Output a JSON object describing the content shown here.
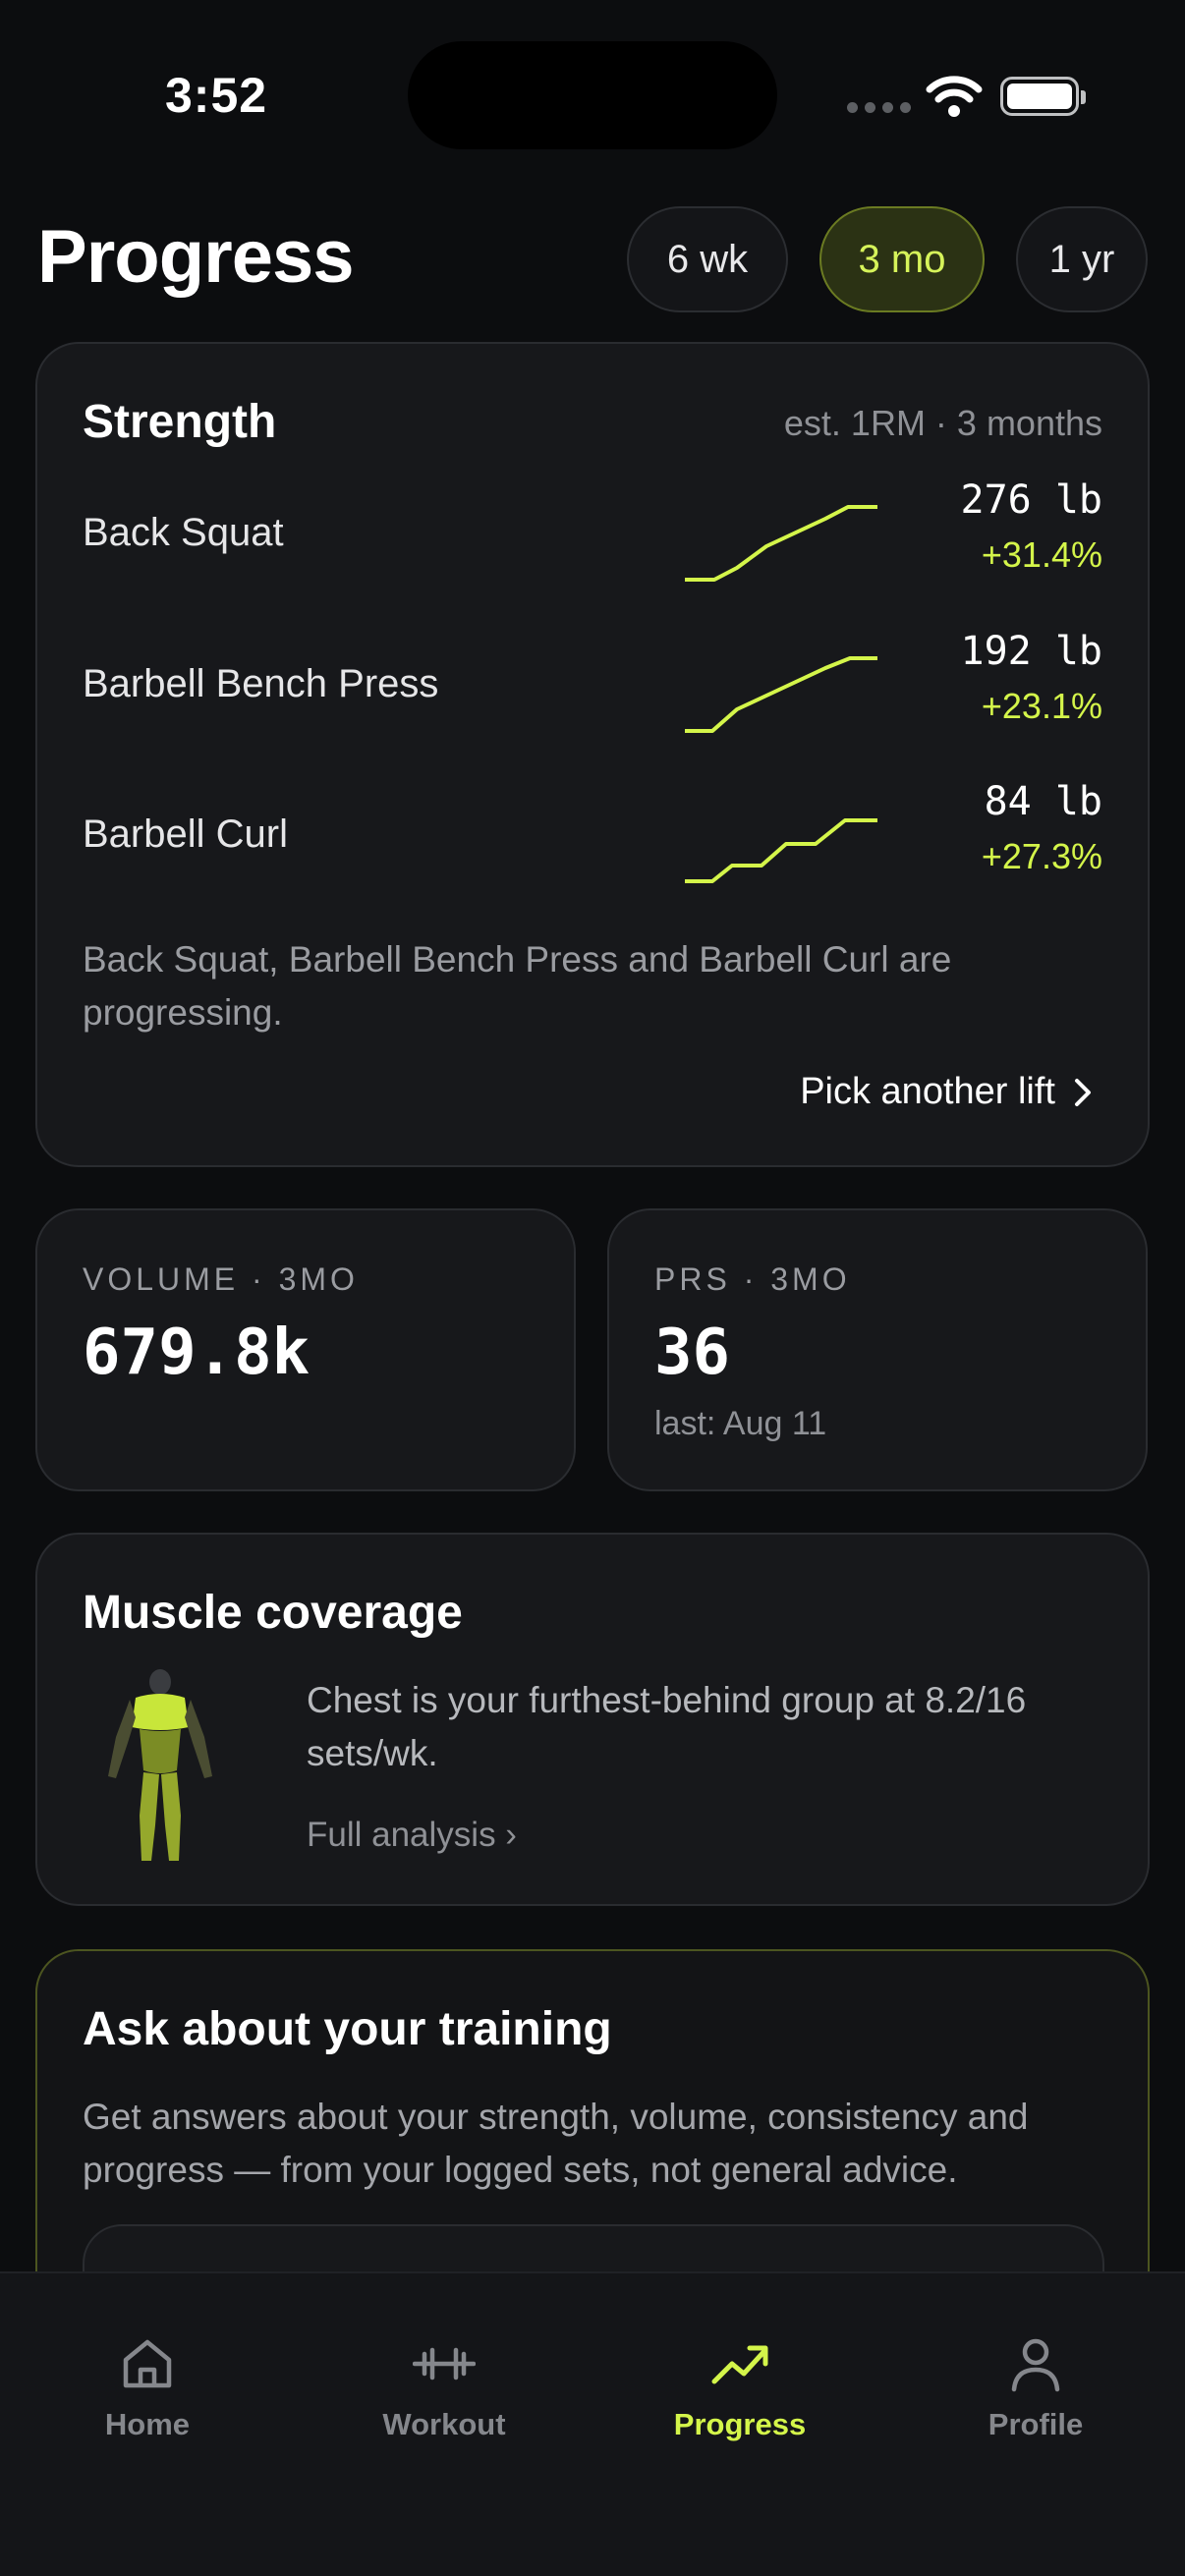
{
  "status_bar": {
    "time": "3:52"
  },
  "header": {
    "title": "Progress",
    "ranges": [
      {
        "label": "6 wk",
        "active": false
      },
      {
        "label": "3 mo",
        "active": true
      },
      {
        "label": "1 yr",
        "active": false
      }
    ]
  },
  "strength": {
    "title": "Strength",
    "meta": "est. 1RM · 3 months",
    "lifts": [
      {
        "name": "Back Squat",
        "value": "276 lb",
        "change": "+31.4%"
      },
      {
        "name": "Barbell Bench Press",
        "value": "192 lb",
        "change": "+23.1%"
      },
      {
        "name": "Barbell Curl",
        "value": "84 lb",
        "change": "+27.3%"
      }
    ],
    "note": "Back Squat, Barbell Bench Press and Barbell Curl are progressing.",
    "pick_label": "Pick another lift"
  },
  "volume": {
    "label": "VOLUME · 3MO",
    "value": "679.8k"
  },
  "prs": {
    "label": "PRS · 3MO",
    "value": "36",
    "sub": "last: Aug 11"
  },
  "muscle": {
    "title": "Muscle coverage",
    "text": "Chest is your furthest-behind group at 8.2/16 sets/wk.",
    "link": "Full analysis ›"
  },
  "ask": {
    "title": "Ask about your training",
    "text": "Get answers about your strength, volume, consistency and progress — from your logged sets, not general advice."
  },
  "tabs": [
    {
      "label": "Home",
      "icon": "home-icon",
      "active": false
    },
    {
      "label": "Workout",
      "icon": "dumbbell-icon",
      "active": false
    },
    {
      "label": "Progress",
      "icon": "trend-up-icon",
      "active": true
    },
    {
      "label": "Profile",
      "icon": "person-icon",
      "active": false
    }
  ],
  "colors": {
    "accent": "#d4f54a",
    "background": "#0c0d0f",
    "card": "#17181b"
  }
}
